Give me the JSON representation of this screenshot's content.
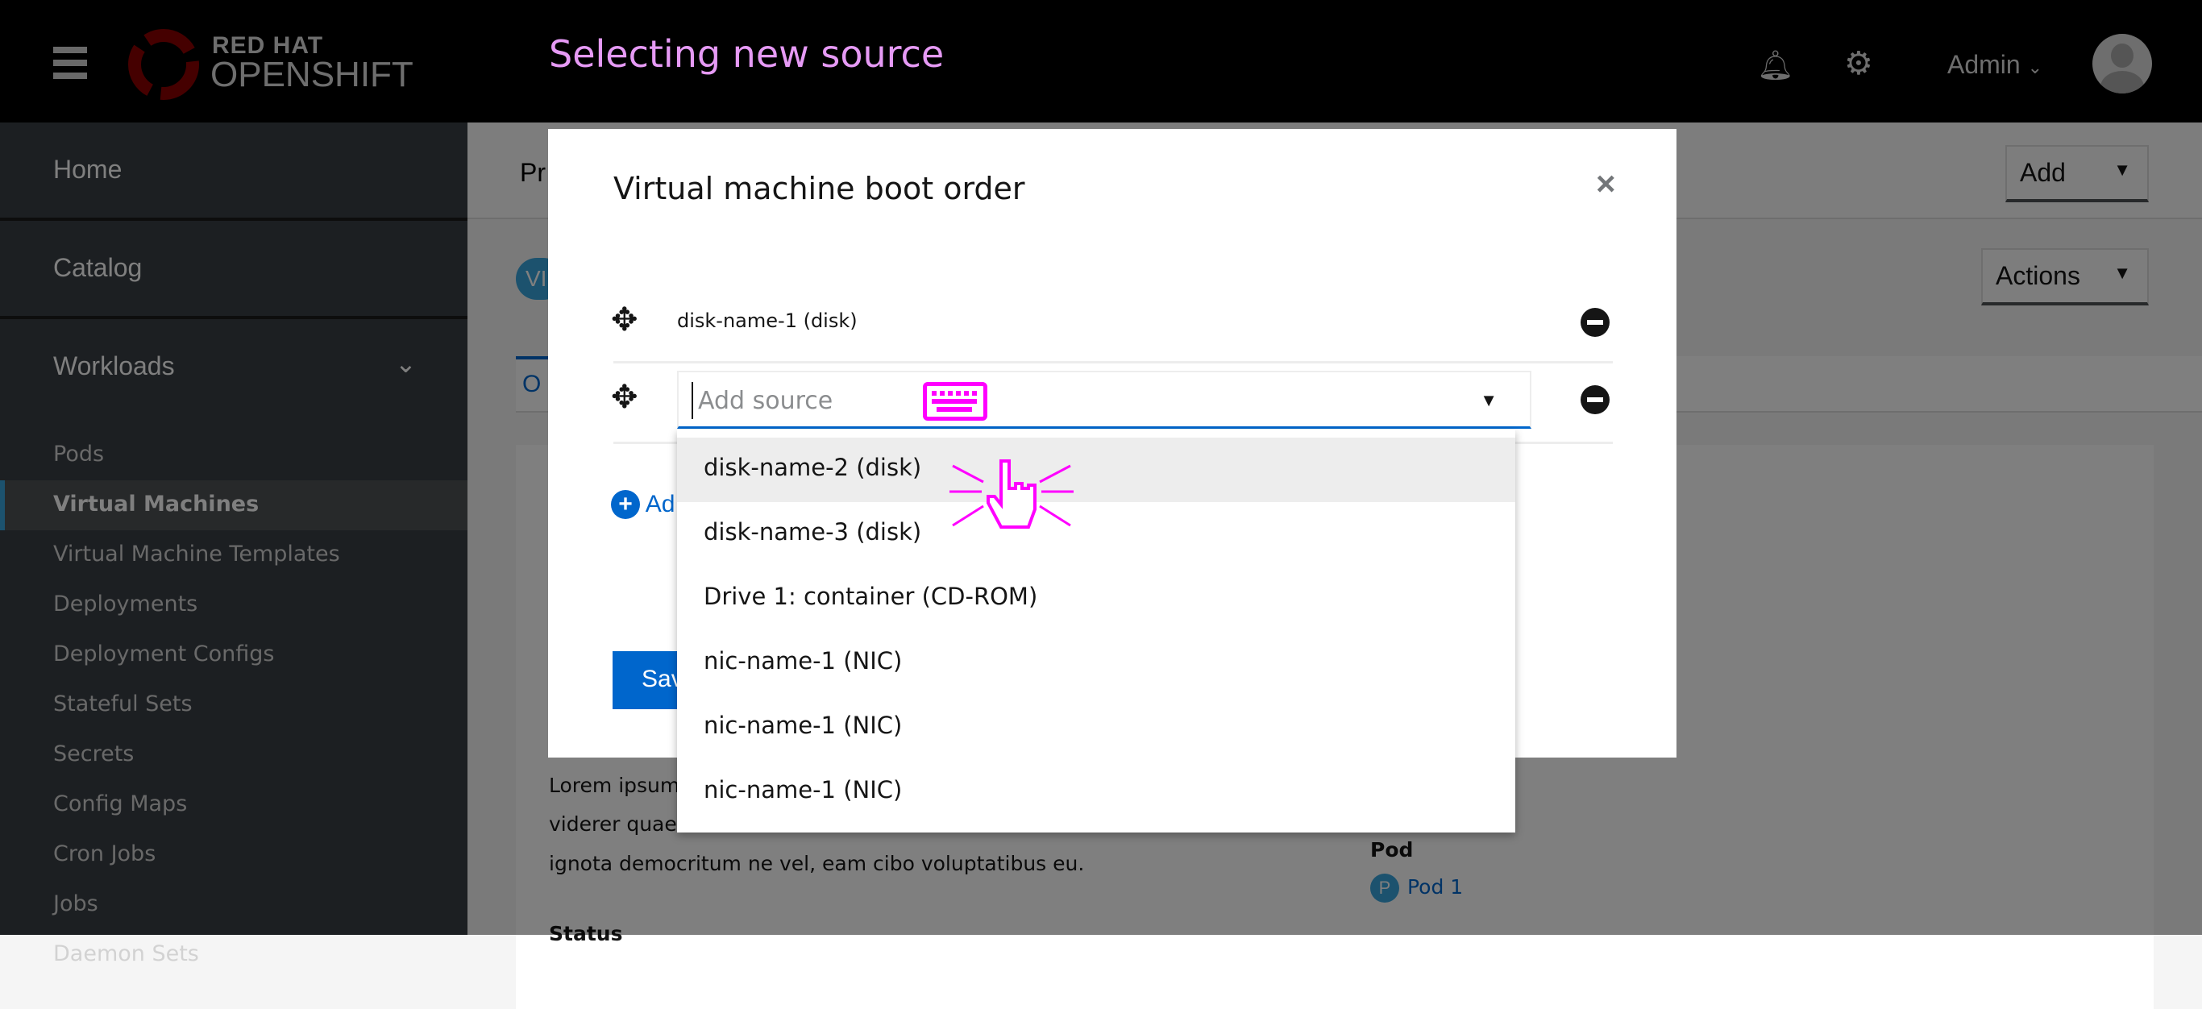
{
  "annotation_title": "Selecting new source",
  "header": {
    "brand_line1": "RED HAT",
    "brand_line2": "OPENSHIFT",
    "user": "Admin",
    "icons": [
      "hamburger-icon",
      "bell-icon",
      "gear-icon",
      "avatar"
    ]
  },
  "sidebar": {
    "groups": [
      "Home",
      "Catalog",
      "Workloads"
    ],
    "items": [
      "Pods",
      "Virtual Machines",
      "Virtual Machine Templates",
      "Deployments",
      "Deployment Configs",
      "Stateful Sets",
      "Secrets",
      "Config Maps",
      "Cron Jobs",
      "Jobs",
      "Daemon Sets"
    ],
    "active": "Virtual Machines"
  },
  "page": {
    "breadcrumb_partial": "Pr",
    "badge_partial": "VI",
    "tab_partial": "O",
    "add_label": "Add",
    "actions_label": "Actions",
    "lorem": [
      "Lorem ipsum",
      "viderer quae",
      "ignota democritum ne vel, eam cibo voluptatibus eu."
    ],
    "pod_label": "Pod",
    "pod_badge": "P",
    "pod_name": "Pod 1",
    "status_partial": "Status"
  },
  "modal": {
    "title": "Virtual machine boot order",
    "close": "×",
    "row1": "disk-name-1 (disk)",
    "select_placeholder": "Add source",
    "add_partial": "Ad",
    "save_partial": "Sav",
    "options": [
      "disk-name-2 (disk)",
      "disk-name-3 (disk)",
      "Drive 1: container (CD-ROM)",
      "nic-name-1 (NIC)",
      "nic-name-1 (NIC)",
      "nic-name-1 (NIC)"
    ]
  },
  "colors": {
    "annotation": "#e69af5",
    "primary": "#0066cc",
    "cursor": "#ff00ff"
  }
}
